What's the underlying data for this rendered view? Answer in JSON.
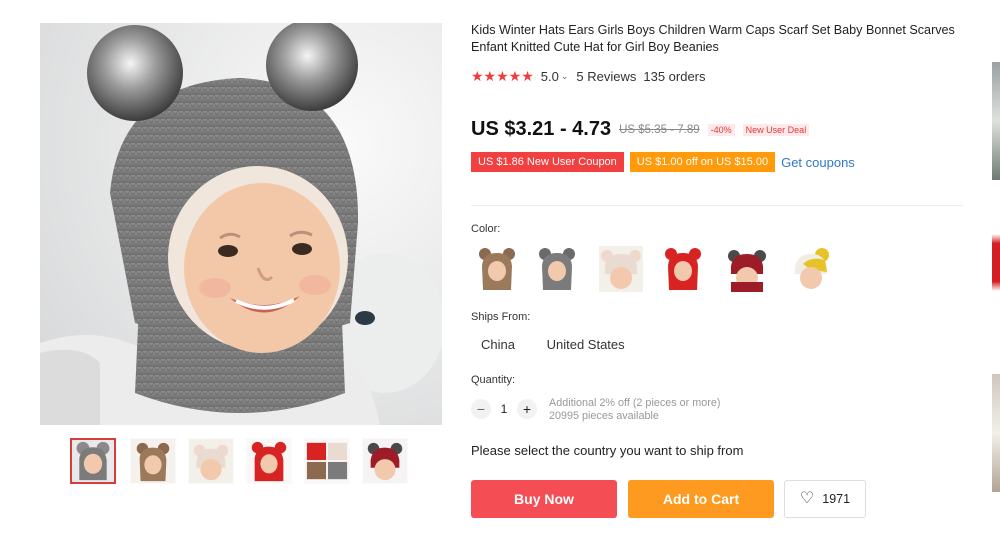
{
  "product": {
    "title": "Kids Winter Hats Ears Girls Boys Children Warm Caps Scarf Set Baby Bonnet Scarves Enfant Knitted Cute Hat for Girl Boy Beanies",
    "stars": "★★★★★",
    "rating": "5.0",
    "reviews": "5 Reviews",
    "orders": "135 orders"
  },
  "pricing": {
    "price": "US $3.21 - 4.73",
    "original_price": "US $5.35 - 7.89",
    "discount": "-40%",
    "new_user_deal": "New User Deal",
    "coupon_new_user": "US $1.86 New User Coupon",
    "coupon_store": "US $1.00 off on US $15.00",
    "get_coupons": "Get coupons"
  },
  "options": {
    "color_label": "Color:",
    "ships_from_label": "Ships From:",
    "ships_from": [
      "China",
      "United States"
    ],
    "quantity_label": "Quantity:",
    "quantity": "1",
    "quantity_note_1": "Additional 2% off (2 pieces or more)",
    "quantity_note_2": "20995 pieces available",
    "ship_message": "Please select the country you want to ship from"
  },
  "actions": {
    "buy_now": "Buy Now",
    "add_to_cart": "Add to Cart",
    "wishlist_count": "1971"
  },
  "icons": {
    "star": "star-icon",
    "chevron": "chevron-down-icon",
    "minus": "minus-icon",
    "plus": "plus-icon",
    "heart": "heart-icon"
  },
  "colors": {
    "accent_red": "#f54d54",
    "accent_orange": "#fd9a1f",
    "link_blue": "#2f78c8",
    "hat_variants": [
      "#8b6a4f",
      "#7b7b7b",
      "#eadbd2",
      "#d82323",
      "#9c1d28",
      "#e7c32a"
    ]
  }
}
